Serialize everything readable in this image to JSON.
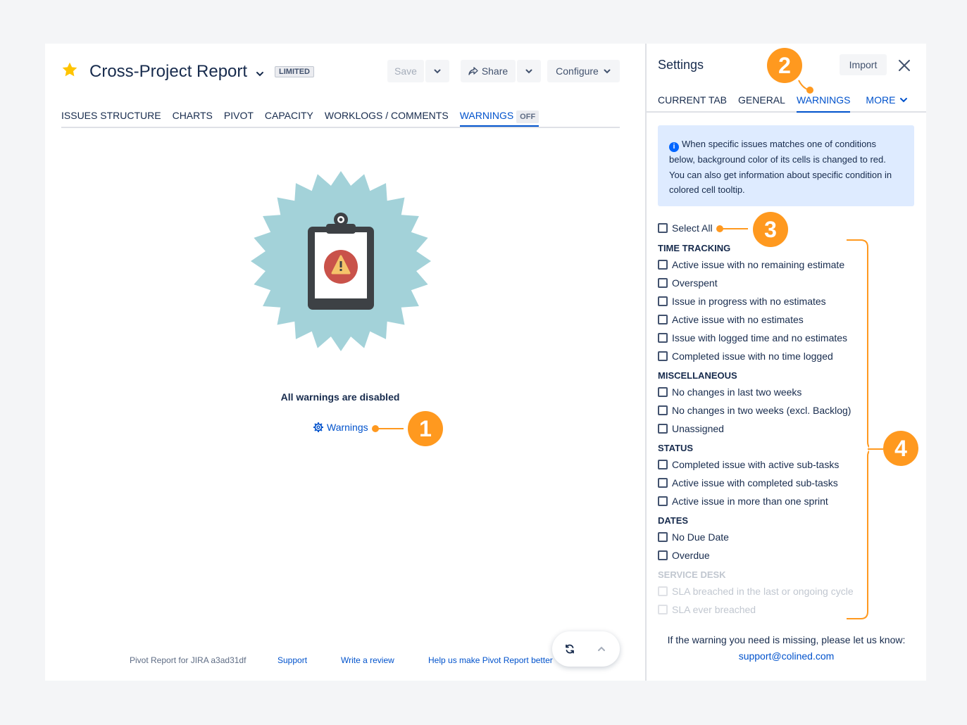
{
  "header": {
    "title": "Cross-Project Report",
    "badge": "LIMITED",
    "save_label": "Save",
    "share_label": "Share",
    "configure_label": "Configure"
  },
  "tabs": [
    {
      "label": "ISSUES STRUCTURE"
    },
    {
      "label": "CHARTS"
    },
    {
      "label": "PIVOT"
    },
    {
      "label": "CAPACITY"
    },
    {
      "label": "WORKLOGS / COMMENTS"
    },
    {
      "label": "WARNINGS",
      "tag": "OFF",
      "active": true
    }
  ],
  "empty_state": {
    "message": "All warnings are disabled",
    "link_label": "Warnings"
  },
  "footer": {
    "product": "Pivot Report for JIRA a3ad31df",
    "support": "Support",
    "review": "Write a review",
    "help": "Help us make Pivot Report better"
  },
  "settings": {
    "title": "Settings",
    "import_label": "Import",
    "tabs": [
      {
        "label": "CURRENT TAB"
      },
      {
        "label": "GENERAL"
      },
      {
        "label": "WARNINGS",
        "active": true
      }
    ],
    "more_label": "MORE",
    "info_text": "When specific issues matches one of conditions below, background color of its cells is changed to red. You can also get information about specific condition in colored cell tooltip.",
    "select_all": "Select All",
    "groups": [
      {
        "name": "TIME TRACKING",
        "items": [
          "Active issue with no remaining estimate",
          "Overspent",
          "Issue in progress with no estimates",
          "Active issue with no estimates",
          "Issue with logged time and no estimates",
          "Completed issue with no time logged"
        ]
      },
      {
        "name": "MISCELLANEOUS",
        "items": [
          "No changes in last two weeks",
          "No changes in two weeks (excl. Backlog)",
          "Unassigned"
        ]
      },
      {
        "name": "STATUS",
        "items": [
          "Completed issue with active sub-tasks",
          "Active issue with completed sub-tasks",
          "Active issue in more than one sprint"
        ]
      },
      {
        "name": "DATES",
        "items": [
          "No Due Date",
          "Overdue"
        ]
      },
      {
        "name": "SERVICE DESK",
        "disabled": true,
        "items": [
          "SLA breached in the last or ongoing cycle",
          "SLA ever breached"
        ]
      }
    ],
    "footer_text": "If the warning you need is missing, please let us know:",
    "footer_email": "support@colined.com"
  },
  "callouts": [
    "1",
    "2",
    "3",
    "4"
  ],
  "colors": {
    "accent": "#0052cc",
    "callout": "#ff991f",
    "star": "#ffc400",
    "badge_bg": "#a3d2d9",
    "warning_red": "#c9524a"
  }
}
